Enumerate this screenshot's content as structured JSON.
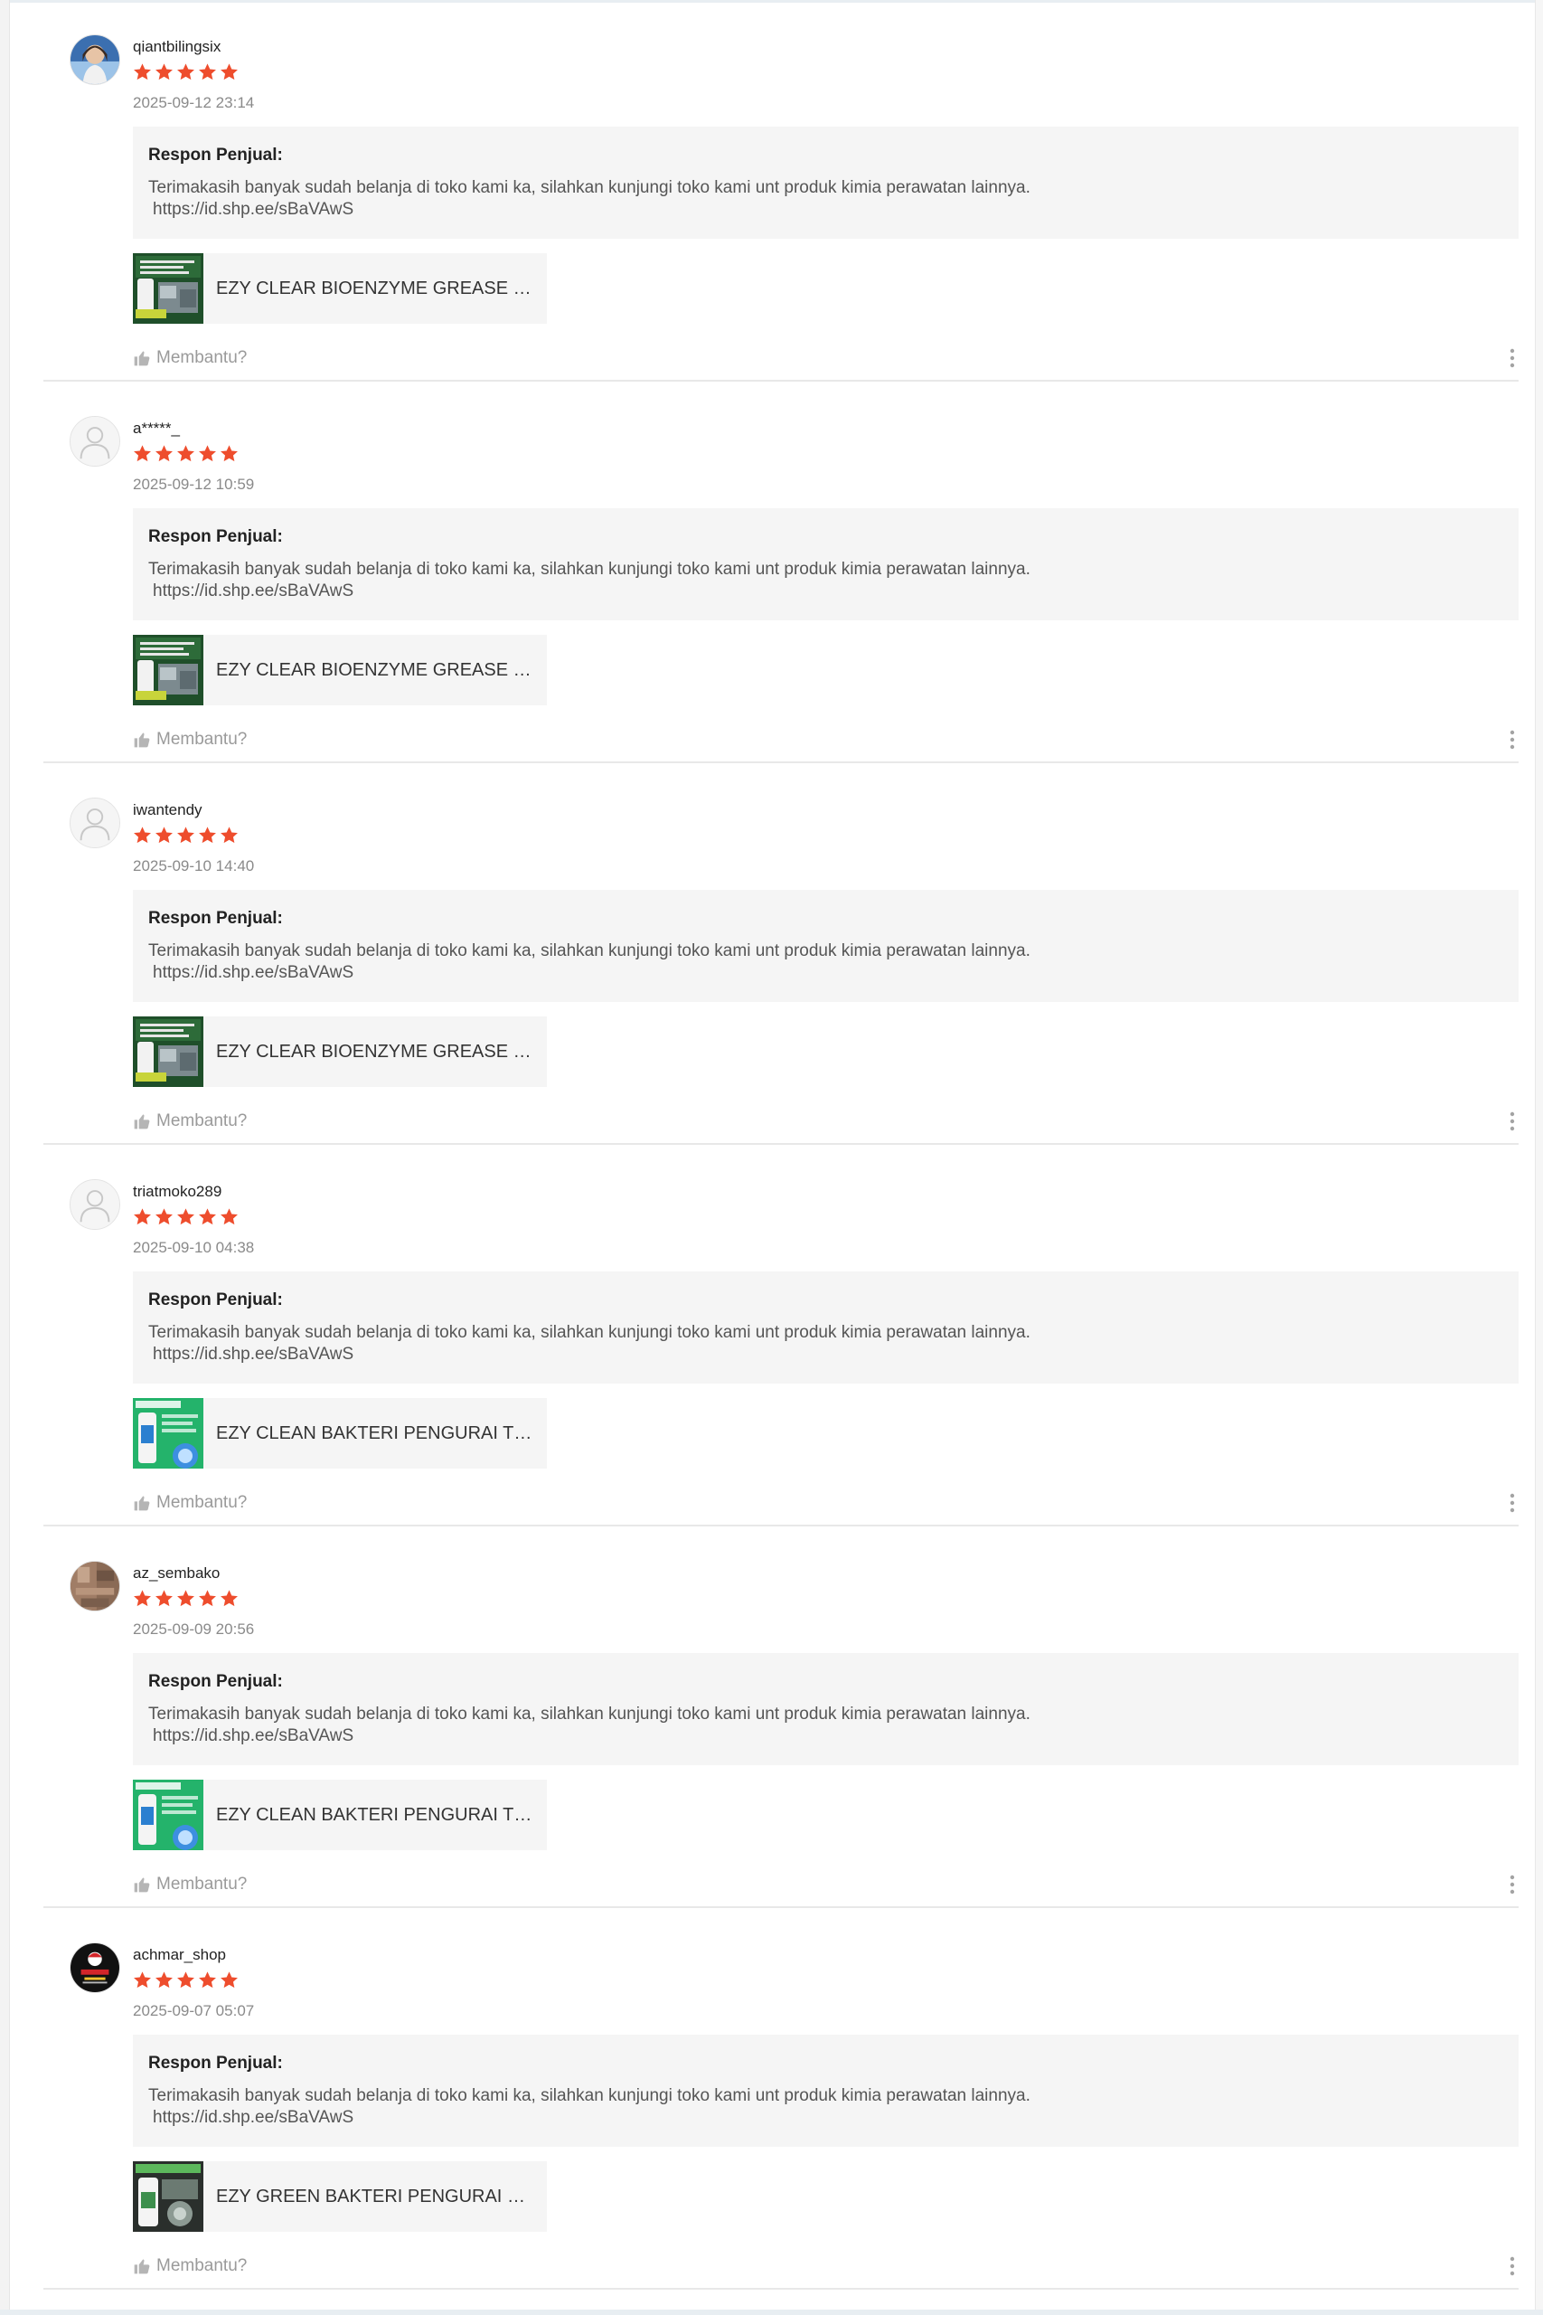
{
  "colors": {
    "star": "#ee4d2d",
    "response_bg": "#f5f5f5",
    "divider": "#e8e8e8",
    "muted_text": "#9a9a9a"
  },
  "reviews": [
    {
      "username": "qiantbilingsix",
      "rating": 5,
      "date": "2025-09-12 23:14",
      "avatar": "photo-avatar",
      "response_title": "Respon Penjual:",
      "response_text": "Terimakasih banyak sudah belanja di toko kami ka, silahkan kunjungi toko kami unt produk kimia perawatan lainnya.",
      "response_link": "https://id.shp.ee/sBaVAwS",
      "product_name": "EZY CLEAR BIOENZYME GREASE EATER",
      "product_thumb": "bioenzyme-product-image",
      "helpful_label": "Membantu?"
    },
    {
      "username": "a*****_",
      "rating": 5,
      "date": "2025-09-12 10:59",
      "avatar": "default-user-avatar",
      "response_title": "Respon Penjual:",
      "response_text": "Terimakasih banyak sudah belanja di toko kami ka, silahkan kunjungi toko kami unt produk kimia perawatan lainnya.",
      "response_link": "https://id.shp.ee/sBaVAwS",
      "product_name": "EZY CLEAR BIOENZYME GREASE EATER",
      "product_thumb": "bioenzyme-product-image",
      "helpful_label": "Membantu?"
    },
    {
      "username": "iwantendy",
      "rating": 5,
      "date": "2025-09-10 14:40",
      "avatar": "default-user-avatar",
      "response_title": "Respon Penjual:",
      "response_text": "Terimakasih banyak sudah belanja di toko kami ka, silahkan kunjungi toko kami unt produk kimia perawatan lainnya.",
      "response_link": "https://id.shp.ee/sBaVAwS",
      "product_name": "EZY CLEAR BIOENZYME GREASE EATER",
      "product_thumb": "bioenzyme-product-image",
      "helpful_label": "Membantu?"
    },
    {
      "username": "triatmoko289",
      "rating": 5,
      "date": "2025-09-10 04:38",
      "avatar": "default-user-avatar",
      "response_title": "Respon Penjual:",
      "response_text": "Terimakasih banyak sudah belanja di toko kami ka, silahkan kunjungi toko kami unt produk kimia perawatan lainnya.",
      "response_link": "https://id.shp.ee/sBaVAwS",
      "product_name": "EZY CLEAN BAKTERI PENGURAI TINJA",
      "product_thumb": "bakteri-product-image",
      "helpful_label": "Membantu?"
    },
    {
      "username": "az_sembako",
      "rating": 5,
      "date": "2025-09-09 20:56",
      "avatar": "photo-avatar-brown",
      "response_title": "Respon Penjual:",
      "response_text": "Terimakasih banyak sudah belanja di toko kami ka, silahkan kunjungi toko kami unt produk kimia perawatan lainnya.",
      "response_link": "https://id.shp.ee/sBaVAwS",
      "product_name": "EZY CLEAN BAKTERI PENGURAI TINJA",
      "product_thumb": "bakteri-product-image",
      "helpful_label": "Membantu?"
    },
    {
      "username": "achmar_shop",
      "rating": 5,
      "date": "2025-09-07 05:07",
      "avatar": "shop-logo-avatar",
      "response_title": "Respon Penjual:",
      "response_text": "Terimakasih banyak sudah belanja di toko kami ka, silahkan kunjungi toko kami unt produk kimia perawatan lainnya.",
      "response_link": "https://id.shp.ee/sBaVAwS",
      "product_name": "EZY GREEN BAKTERI PENGURAI LIMBAH",
      "product_thumb": "green-product-image",
      "helpful_label": "Membantu?"
    }
  ]
}
